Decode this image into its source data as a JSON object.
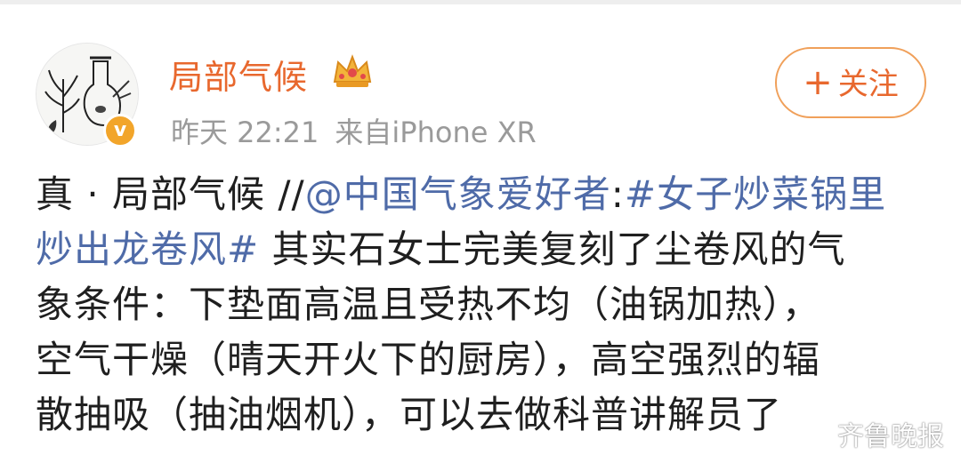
{
  "post": {
    "username": "局部气候",
    "timestamp": "昨天 22:21",
    "source": "来自iPhone XR",
    "follow_label": "关注",
    "follow_plus": "+",
    "verified_mark": "v",
    "icons": {
      "verified": "verified-v-badge",
      "crown": "crown-icon",
      "avatar": "botanical-illustration-avatar"
    },
    "body": {
      "line1_plain": "真 · 局部气候 //",
      "line1_mention": "@中国气象爱好者",
      "line1_colon": ":",
      "line1_hashtag": "#女子炒菜锅里",
      "line2_hashtag": "炒出龙卷风#",
      "line2_plain": " 其实石女士完美复刻了尘卷风的气",
      "line3": "象条件：下垫面高温且受热不均（油锅加热），",
      "line4": "空气干燥（晴天开火下的厨房），高空强烈的辐",
      "line5": "散抽吸（抽油烟机），可以去做科普讲解员了"
    }
  },
  "watermark": {
    "text": "齐鲁晚报",
    "icon": "wechat-icon"
  },
  "colors": {
    "username": "#e8682e",
    "link": "#4f6ba8",
    "meta": "#9a9a9a",
    "badge": "#f2a52a"
  }
}
